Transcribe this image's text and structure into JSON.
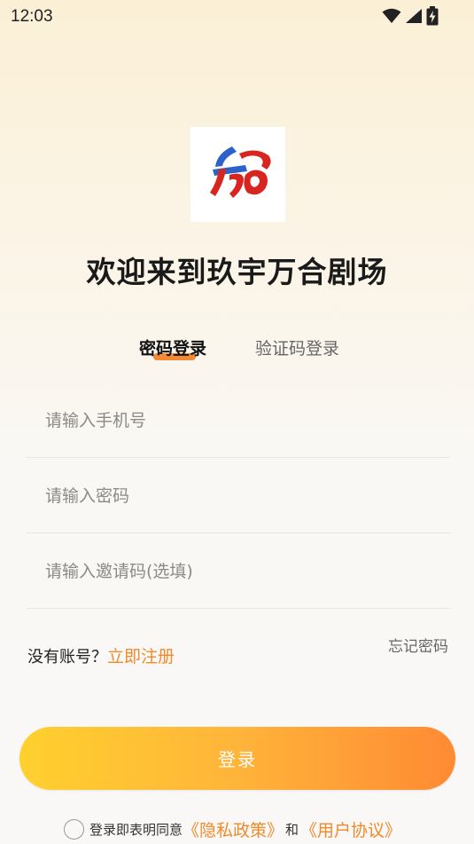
{
  "status_bar": {
    "time": "12:03",
    "icons": [
      "wifi-icon",
      "cellular-signal-icon",
      "battery-charging-icon"
    ]
  },
  "logo": {
    "icon": "wanhe-logo-icon",
    "colors": {
      "red": "#d8251f",
      "blue": "#2c62c9"
    }
  },
  "welcome_title": "欢迎来到玖宇万合剧场",
  "tabs": [
    {
      "label": "密码登录",
      "active": true
    },
    {
      "label": "验证码登录",
      "active": false
    }
  ],
  "form": {
    "phone_placeholder": "请输入手机号",
    "password_placeholder": "请输入密码",
    "invite_placeholder": "请输入邀请码(选填)"
  },
  "register": {
    "prompt": "没有账号？",
    "link": "立即注册"
  },
  "forgot_password": "忘记密码",
  "login_button": "登录",
  "agreement": {
    "prefix": "登录即表明同意",
    "privacy_policy": "《隐私政策》",
    "and": "和",
    "user_agreement": "《用户协议》",
    "checked": false
  },
  "colors": {
    "accent": "#f08a2a",
    "button_gradient_start": "#ffd02e",
    "button_gradient_end": "#ff8a33"
  }
}
